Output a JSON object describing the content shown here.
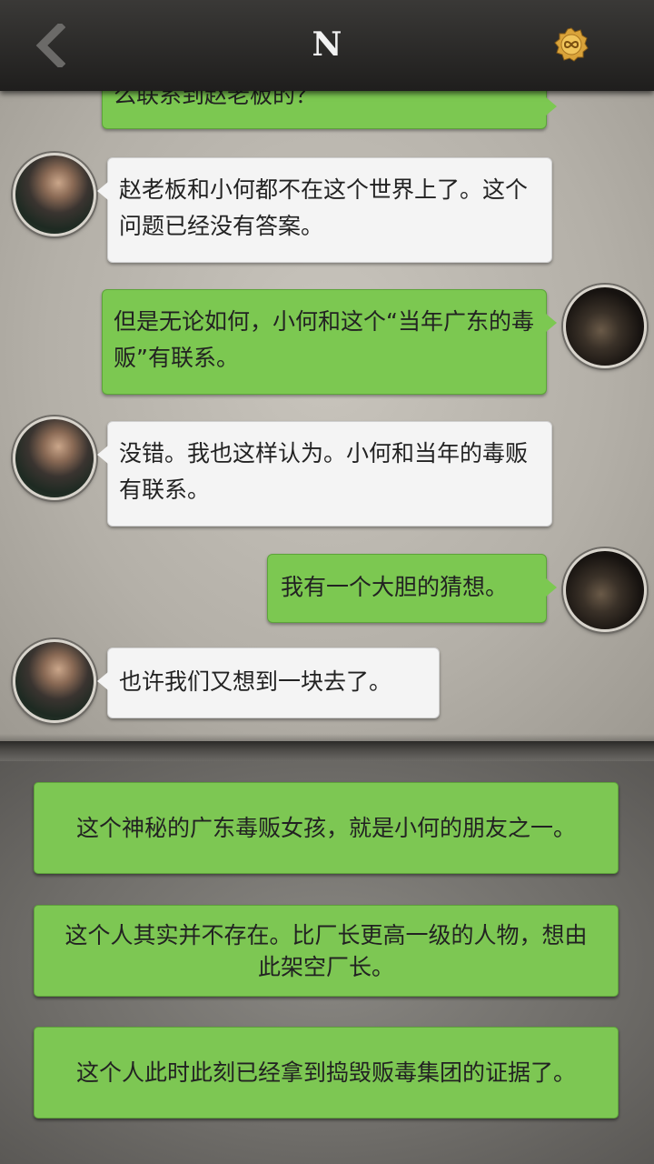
{
  "header": {
    "title": "N",
    "back_icon": "chevron-left-icon",
    "coin_icon": "infinity-coin-icon"
  },
  "messages": [
    {
      "side": "me",
      "text": "么联系到赵老板的？"
    },
    {
      "side": "npc",
      "text": "赵老板和小何都不在这个世界上了。这个问题已经没有答案。"
    },
    {
      "side": "me",
      "text": "但是无论如何，小何和这个“当年广东的毒贩”有联系。"
    },
    {
      "side": "npc",
      "text": "没错。我也这样认为。小何和当年的毒贩有联系。"
    },
    {
      "side": "me",
      "text": "我有一个大胆的猜想。"
    },
    {
      "side": "npc",
      "text": "也许我们又想到一块去了。"
    }
  ],
  "choices": [
    {
      "text": "这个神秘的广东毒贩女孩，就是小何的朋友之一。"
    },
    {
      "text": "这个人其实并不存在。比厂长更高一级的人物，想由此架空厂长。"
    },
    {
      "text": "这个人此时此刻已经拿到捣毁贩毒集团的证据了。"
    }
  ],
  "colors": {
    "green_bubble": "#7cc851",
    "white_bubble": "#f4f4f4",
    "header": "#2a2927"
  }
}
